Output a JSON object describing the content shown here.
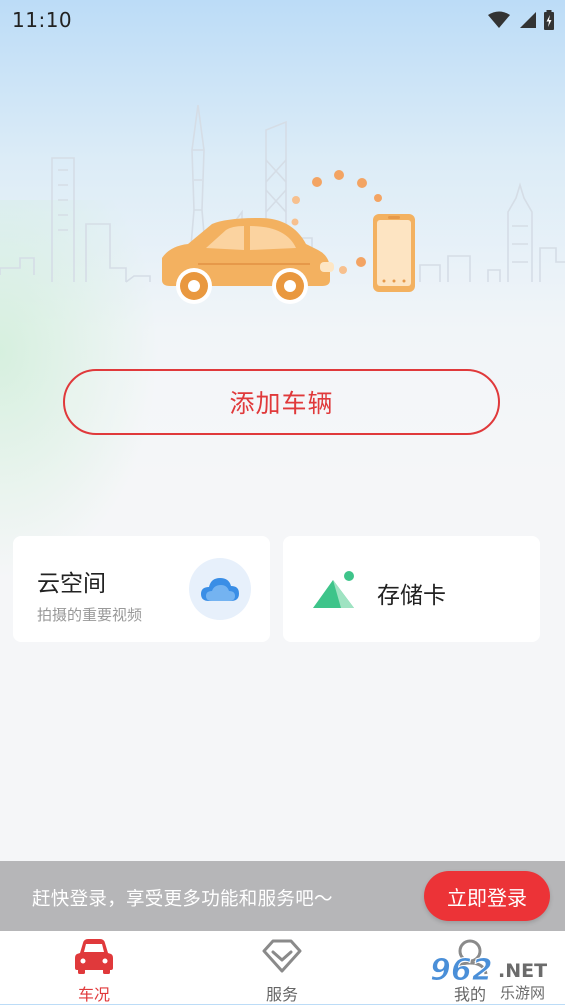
{
  "status_bar": {
    "time": "11:10"
  },
  "hero": {
    "illustration": "car-connected-to-phone"
  },
  "main": {
    "add_vehicle_label": "添加车辆",
    "cards": {
      "cloud": {
        "title": "云空间",
        "subtitle": "拍摄的重要视频",
        "icon": "cloud-icon"
      },
      "sd": {
        "title": "存储卡",
        "icon": "sd-card-icon"
      }
    }
  },
  "login_banner": {
    "text": "赶快登录，享受更多功能和服务吧～",
    "button_label": "立即登录"
  },
  "tab_bar": {
    "items": [
      {
        "label": "车况",
        "icon": "car-icon",
        "active": true
      },
      {
        "label": "服务",
        "icon": "diamond-icon",
        "active": false
      },
      {
        "label": "我的",
        "icon": "profile-icon",
        "active": false
      }
    ]
  },
  "watermark": {
    "number": "962",
    "suffix": ".NET",
    "caption": "乐游网"
  },
  "colors": {
    "accent": "#e0393b",
    "login_button": "#ec3337",
    "car_body": "#f3b160",
    "sd_icon": "#3ec48a"
  }
}
